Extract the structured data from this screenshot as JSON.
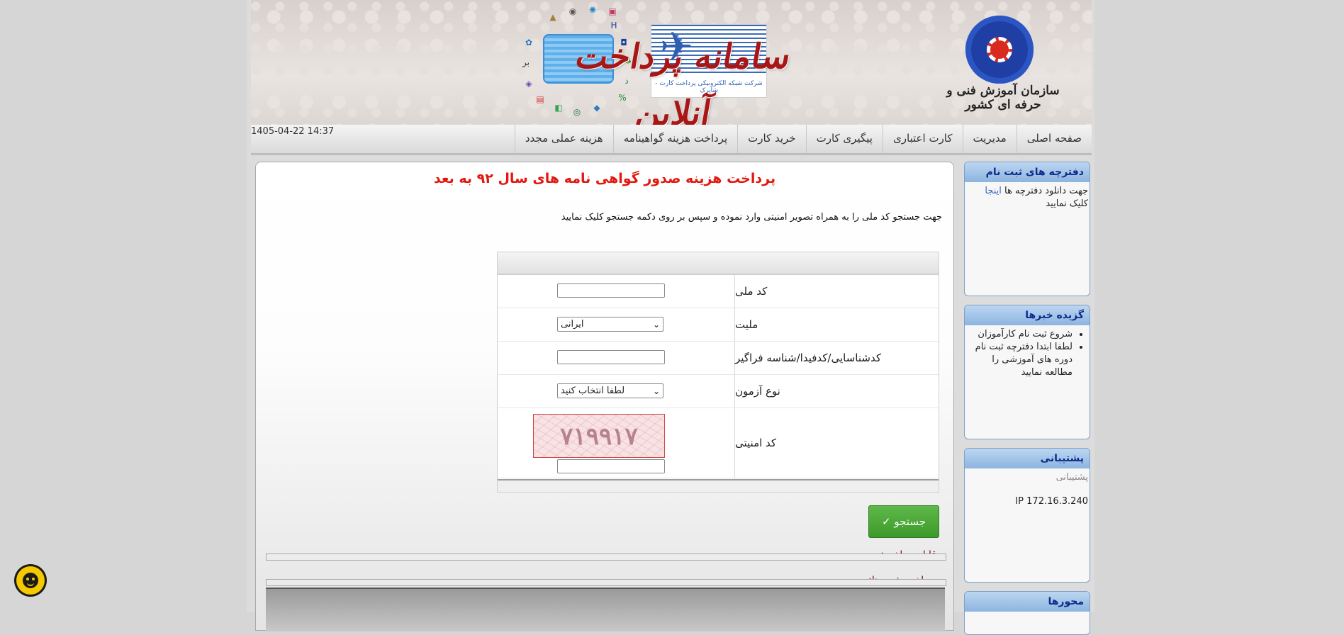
{
  "header": {
    "title": "سامانه پرداخت آنلاین",
    "org_name": "سازمان آموزش فنی و حرفه ای کشور",
    "shaparak_text": "شرکت شبکه الکترونیکی پرداخت کارت - شاپرک"
  },
  "menu": {
    "items": [
      {
        "label": "صفحه اصلی"
      },
      {
        "label": "مدیریت"
      },
      {
        "label": "کارت اعتباری"
      },
      {
        "label": "پیگیری کارت"
      },
      {
        "label": "خرید کارت"
      },
      {
        "label": "پرداخت هزینه گواهینامه"
      },
      {
        "label": "هزینه عملی مجدد"
      }
    ],
    "datetime": "1405-04-22 14:37"
  },
  "sidebar": {
    "download": {
      "title": "دفترچه های ثبت نام",
      "text_before": "جهت دانلود دفترچه ها ",
      "link": "اینجا",
      "text_after": " کلیک نمایید"
    },
    "news": {
      "title": "گزیده خبرها",
      "items": [
        "شروع ثبت نام کارآموزان",
        "لطفا ابتدا دفترچه ثبت نام دوره های آموزشی را مطالعه نمایید"
      ]
    },
    "support": {
      "title": "پشتیبانی",
      "link": "پشتیبانی",
      "ip": "IP 172.16.3.240"
    },
    "axes": {
      "title": "محورها"
    }
  },
  "main": {
    "title": "پرداخت هزینه صدور گواهی نامه های سال ۹۲ به بعد",
    "instruction": "جهت جستجو کد ملی را به همراه تصویر امنیتی وارد نموده و سپس بر روی دکمه جستجو کلیک نمایید",
    "form": {
      "national_code_label": "کد ملی",
      "national_code_value": "",
      "nationality_label": "ملیت",
      "nationality_selected": "ایرانی",
      "id_label": "کدشناسایی/کدفیدا/شناسه فراگیر",
      "id_value": "",
      "exam_type_label": "نوع آزمون",
      "exam_type_selected": "لطفا انتخاب کنید",
      "captcha_label": "کد امنیتی",
      "captcha_text": "۷۱۹۹۱۷",
      "captcha_value": ""
    },
    "search_button": "جستجو ✓",
    "payable_label": "قابل پرداخت:",
    "paid_label": "پرداخت شده ها:"
  },
  "colors": {
    "accent_red": "#e3170f",
    "button_green": "#3c9a2a",
    "panel_head": "#8db4df"
  }
}
